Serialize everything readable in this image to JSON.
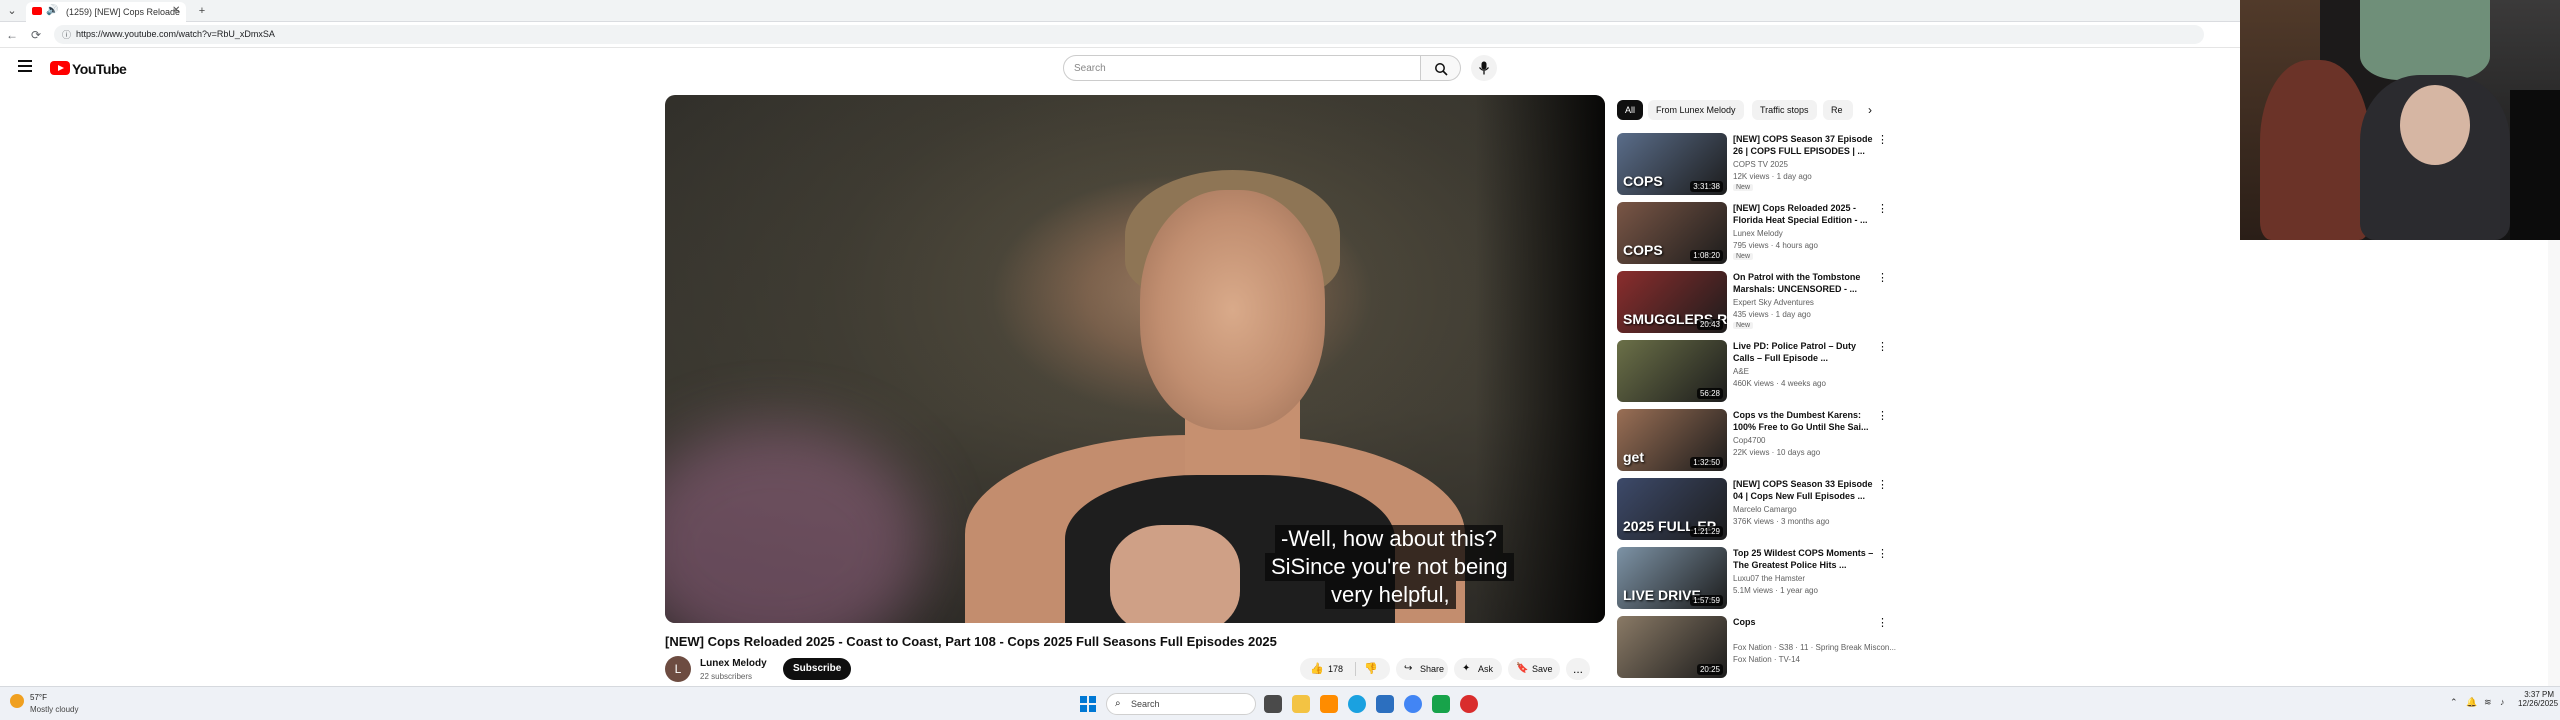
{
  "browser": {
    "tab_title": "(1259) [NEW] Cops Reloade",
    "new_tab": "+",
    "url": "https://www.youtube.com/watch?v=RbU_xDmxSA"
  },
  "youtube": {
    "logo_text": "YouTube",
    "search_placeholder": "Search"
  },
  "video": {
    "captions": [
      "-Well, how about this?",
      "SiSince you're not being",
      "very helpful,"
    ],
    "title": "[NEW] Cops Reloaded 2025 - Coast to Coast, Part 108 - Cops 2025 Full Seasons Full Episodes 2025",
    "channel_initial": "L",
    "channel_name": "Lunex Melody",
    "subscribers": "22 subscribers",
    "subscribe_label": "Subscribe",
    "likes": "178",
    "share_label": "Share",
    "ask_label": "Ask",
    "save_label": "Save",
    "more_label": "..."
  },
  "chips": [
    "All",
    "From Lunex Melody",
    "Traffic stops",
    "Re"
  ],
  "recommendations": [
    {
      "title": "[NEW] COPS Season 37 Episode 26 | COPS FULL EPISODES | ...",
      "channel": "COPS TV 2025",
      "meta": "12K views · 1 day ago",
      "badge": "New",
      "duration": "3:31:38",
      "thumb_color": "#5a6d8a",
      "thumb_text": "COPS"
    },
    {
      "title": "[NEW] Cops Reloaded 2025 - Florida Heat Special Edition - ...",
      "channel": "Lunex Melody",
      "meta": "795 views · 4 hours ago",
      "badge": "New",
      "duration": "1:08:20",
      "thumb_color": "#7a5646",
      "thumb_text": "COPS"
    },
    {
      "title": "On Patrol with the Tombstone Marshals: UNCENSORED - ...",
      "channel": "Expert Sky Adventures",
      "meta": "435 views · 1 day ago",
      "badge": "New",
      "duration": "20:43",
      "thumb_color": "#8b2d2d",
      "thumb_text": "SMUGGLERS RUN"
    },
    {
      "title": "Live PD: Police Patrol – Duty Calls – Full Episode ...",
      "channel": "A&E",
      "meta": "460K views · 4 weeks ago",
      "badge": "",
      "duration": "56:28",
      "thumb_color": "#6b7048",
      "thumb_text": ""
    },
    {
      "title": "Cops vs the Dumbest Karens: 100% Free to Go Until She Sai...",
      "channel": "Cop4700",
      "meta": "22K views · 10 days ago",
      "badge": "",
      "duration": "1:32:50",
      "thumb_color": "#9a6f55",
      "thumb_text": "get"
    },
    {
      "title": "[NEW] COPS Season 33 Episode 04 | Cops New Full Episodes ...",
      "channel": "Marcelo Camargo",
      "meta": "376K views · 3 months ago",
      "badge": "",
      "duration": "1:21:29",
      "thumb_color": "#3d4a6a",
      "thumb_text": "2025 FULL EP"
    },
    {
      "title": "Top 25 Wildest COPS Moments – The Greatest Police Hits ...",
      "channel": "Luxu07 the Hamster",
      "meta": "5.1M views · 1 year ago",
      "badge": "",
      "duration": "1:57:59",
      "thumb_color": "#7d93a6",
      "thumb_text": "LIVE DRIVE"
    },
    {
      "title": "Cops",
      "channel": "Fox Nation · S38 · 11 · Spring Break Miscon...",
      "meta": "Fox Nation · TV-14",
      "badge": "",
      "duration": "20:25",
      "thumb_color": "#8a7a66",
      "thumb_text": ""
    }
  ],
  "taskbar": {
    "temperature": "57°F",
    "condition": "Mostly cloudy",
    "search_label": "Search",
    "time": "3:37 PM",
    "date": "12/26/2025"
  }
}
